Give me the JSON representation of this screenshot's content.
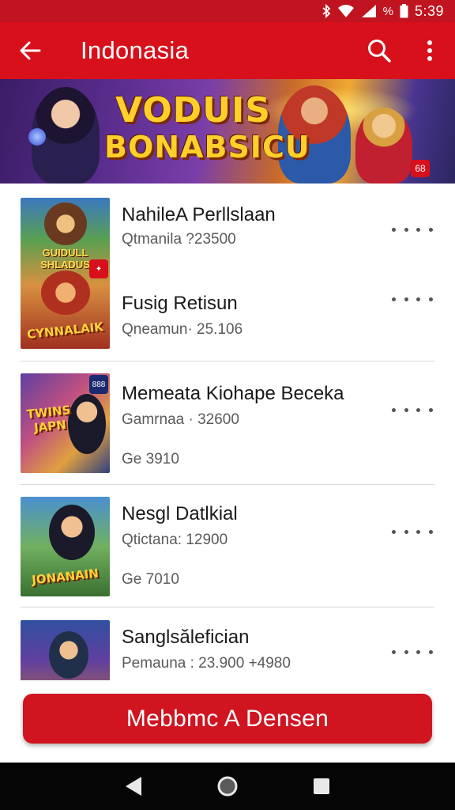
{
  "status_bar": {
    "time": "5:39",
    "icons": [
      "bluetooth-icon",
      "wifi-icon",
      "signal-icon",
      "battery-icon"
    ],
    "battery_label": "%"
  },
  "app_bar": {
    "title": "Indonasia",
    "back_icon": "arrow-left-icon",
    "search_icon": "search-icon",
    "menu_icon": "more-vert-icon"
  },
  "banner": {
    "line1": "VODUIS",
    "line2": "BONABSICU",
    "badge": "68"
  },
  "items": [
    {
      "title": "NahileA Perllslaan",
      "subtitle": "Qtmanila ?23500",
      "thumb_caption": "GUIDULL SHLADUS"
    },
    {
      "title": "Fusig Retisun",
      "subtitle": "Qneamun· 25.106",
      "thumb_caption": "CYNNALAIK"
    },
    {
      "title": "Memeata Kiohape Beceka",
      "subtitle": "Gamrnaa · 32600",
      "extra": "Ge 3910",
      "thumb_caption": "TWINS JAPN"
    },
    {
      "title": "Nesgl Datlkial",
      "subtitle": "Qtictana: 12900",
      "extra": "Ge 7010",
      "thumb_caption": "JONANAIN"
    },
    {
      "title": "Sanglsălefician",
      "subtitle": "Pemauna : 23.900 +4980"
    }
  ],
  "cta": {
    "label": "Mebbmc A Densen"
  },
  "nav": {
    "back_icon": "nav-back-icon",
    "home_icon": "nav-home-icon",
    "recents_icon": "nav-recents-icon"
  },
  "colors": {
    "primary": "#d8101c",
    "status": "#c01420",
    "nav": "#050505"
  }
}
